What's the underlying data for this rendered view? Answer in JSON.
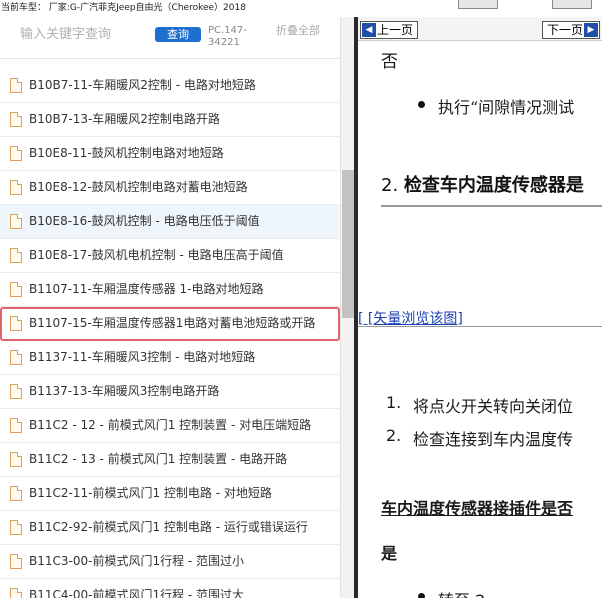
{
  "topbar": {
    "vehicle_text": "当前车型：  厂家:G-广汽菲克Jeep自由光（Cherokee）2018"
  },
  "search": {
    "placeholder": "输入关键字查询",
    "query_label": "查询",
    "pc_code": "PC.147-34221",
    "collapse_label": "折叠全部"
  },
  "list": {
    "items": [
      {
        "label": "B10B7-11-车厢暖风2控制 - 电路对地短路"
      },
      {
        "label": "B10B7-13-车厢暖风2控制电路开路"
      },
      {
        "label": "B10E8-11-鼓风机控制电路对地短路"
      },
      {
        "label": "B10E8-12-鼓风机控制电路对蓄电池短路"
      },
      {
        "label": "B10E8-16-鼓风机控制 - 电路电压低于阈值"
      },
      {
        "label": "B10E8-17-鼓风机电机控制 - 电路电压高于阈值"
      },
      {
        "label": "B1107-11-车厢温度传感器 1-电路对地短路"
      },
      {
        "label": "B1107-15-车厢温度传感器1电路对蓄电池短路或开路"
      },
      {
        "label": "B1137-11-车厢暖风3控制 - 电路对地短路"
      },
      {
        "label": "B1137-13-车厢暖风3控制电路开路"
      },
      {
        "label": "B11C2 - 12 - 前模式风门1 控制装置 - 对电压端短路"
      },
      {
        "label": "B11C2 - 13 - 前模式风门1 控制装置 - 电路开路"
      },
      {
        "label": "B11C2-11-前模式风门1 控制电路 - 对地短路"
      },
      {
        "label": "B11C2-92-前模式风门1 控制电路 - 运行或错误运行"
      },
      {
        "label": "B11C3-00-前模式风门1行程 - 范围过小"
      },
      {
        "label": "B11C4-00-前模式风门1行程 - 范围过大"
      }
    ]
  },
  "content": {
    "prev_label": "上一页",
    "next_label": "下一页",
    "fou": "否",
    "bullet1": "执行“间隙情况测试",
    "step2_num": "2.",
    "step2_text": "检查车内温度传感器是",
    "vector_link": "[ [矢量浏览该图]",
    "ol1_num": "1.",
    "ol1_text": "将点火开关转向关闭位",
    "ol2_num": "2.",
    "ol2_text": "检查连接到车内温度传",
    "connector_question": "车内温度传感器接插件是否",
    "answer_yes": "是",
    "goto_text": "转至 2"
  },
  "colors": {
    "query_button": "#1e6fd0",
    "selected_outline": "#e0636d",
    "hover_row": "#eef5fb",
    "nav_arrow": "#1f4fa8",
    "link": "#1a3fb0"
  },
  "icons": {
    "list_item": "document-icon",
    "prev": "arrow-left-icon",
    "next": "arrow-right-icon"
  }
}
